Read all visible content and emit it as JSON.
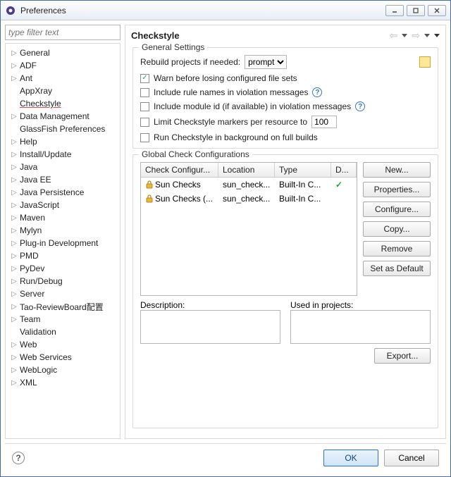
{
  "window": {
    "title": "Preferences"
  },
  "filter": {
    "placeholder": "type filter text"
  },
  "tree": {
    "items": [
      {
        "label": "General",
        "leaf": false
      },
      {
        "label": "ADF",
        "leaf": false
      },
      {
        "label": "Ant",
        "leaf": false
      },
      {
        "label": "AppXray",
        "leaf": true
      },
      {
        "label": "Checkstyle",
        "leaf": true,
        "selected": true
      },
      {
        "label": "Data Management",
        "leaf": false
      },
      {
        "label": "GlassFish Preferences",
        "leaf": true
      },
      {
        "label": "Help",
        "leaf": false
      },
      {
        "label": "Install/Update",
        "leaf": false
      },
      {
        "label": "Java",
        "leaf": false
      },
      {
        "label": "Java EE",
        "leaf": false
      },
      {
        "label": "Java Persistence",
        "leaf": false
      },
      {
        "label": "JavaScript",
        "leaf": false
      },
      {
        "label": "Maven",
        "leaf": false
      },
      {
        "label": "Mylyn",
        "leaf": false
      },
      {
        "label": "Plug-in Development",
        "leaf": false
      },
      {
        "label": "PMD",
        "leaf": false
      },
      {
        "label": "PyDev",
        "leaf": false
      },
      {
        "label": "Run/Debug",
        "leaf": false
      },
      {
        "label": "Server",
        "leaf": false
      },
      {
        "label": "Tao-ReviewBoard配置",
        "leaf": false
      },
      {
        "label": "Team",
        "leaf": false
      },
      {
        "label": "Validation",
        "leaf": true
      },
      {
        "label": "Web",
        "leaf": false
      },
      {
        "label": "Web Services",
        "leaf": false
      },
      {
        "label": "WebLogic",
        "leaf": false
      },
      {
        "label": "XML",
        "leaf": false
      }
    ]
  },
  "page": {
    "title": "Checkstyle",
    "general": {
      "legend": "General Settings",
      "rebuild_label": "Rebuild projects if needed:",
      "rebuild_value": "prompt",
      "warn": {
        "checked": true,
        "label": "Warn before losing configured file sets"
      },
      "include_names": {
        "checked": false,
        "label": "Include rule names in violation messages"
      },
      "include_module": {
        "checked": false,
        "label": "Include module id (if available) in violation messages"
      },
      "limit": {
        "checked": false,
        "label": "Limit Checkstyle markers per resource to",
        "value": "100"
      },
      "background": {
        "checked": false,
        "label": "Run Checkstyle in background on full builds"
      }
    },
    "global": {
      "legend": "Global Check Configurations",
      "headers": {
        "c1": "Check Configur...",
        "c2": "Location",
        "c3": "Type",
        "c4": "D..."
      },
      "rows": [
        {
          "name": "Sun Checks",
          "location": "sun_check...",
          "type": "Built-In C...",
          "default": true
        },
        {
          "name": "Sun Checks (...",
          "location": "sun_check...",
          "type": "Built-In C...",
          "default": false
        }
      ],
      "buttons": {
        "new": "New...",
        "properties": "Properties...",
        "configure": "Configure...",
        "copy": "Copy...",
        "remove": "Remove",
        "setdefault": "Set as Default"
      },
      "desc_label": "Description:",
      "used_label": "Used in projects:",
      "export": "Export..."
    }
  },
  "footer": {
    "ok": "OK",
    "cancel": "Cancel"
  }
}
